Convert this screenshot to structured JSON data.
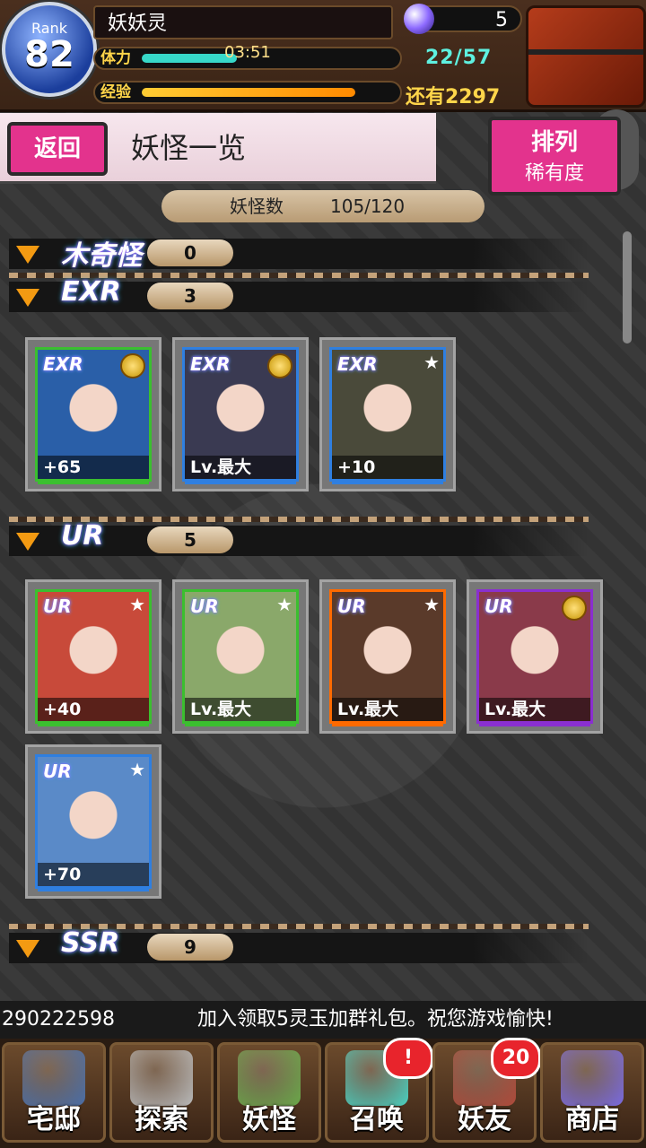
{
  "header": {
    "rank_label": "Rank",
    "rank_value": "82",
    "player_name": "妖妖灵",
    "stamina_label": "体力",
    "stamina_timer": "03:51",
    "stamina_value": "22/57",
    "stamina_fill": 0.38,
    "exp_label": "经验",
    "exp_remaining": "还有2297",
    "exp_fill": 0.85,
    "gems": "5"
  },
  "titlebar": {
    "back_label": "返回",
    "title": "妖怪一览",
    "sort_label": "排列",
    "sort_value": "稀有度"
  },
  "count": {
    "label": "妖怪数",
    "value": "105/120"
  },
  "sections": [
    {
      "rarity": "木奇怪",
      "count": "0"
    },
    {
      "rarity": "EXR",
      "count": "3"
    },
    {
      "rarity": "UR",
      "count": "5"
    },
    {
      "rarity": "SSR",
      "count": "9"
    }
  ],
  "exr_cards": [
    {
      "rarity": "EXR",
      "level": "+65",
      "badge": "medal",
      "frame": "#3bbf2f",
      "art": "#2a5fa8"
    },
    {
      "rarity": "EXR",
      "level": "Lv.最大",
      "badge": "medal",
      "frame": "#2f7fe0",
      "art": "#3a3a52"
    },
    {
      "rarity": "EXR",
      "level": "+10",
      "badge": "star",
      "frame": "#2f7fe0",
      "art": "#4a4a3a"
    }
  ],
  "ur_cards": [
    {
      "rarity": "UR",
      "level": "+40",
      "badge": "star",
      "frame": "#3bbf2f",
      "art": "#c84a3a"
    },
    {
      "rarity": "UR",
      "level": "Lv.最大",
      "badge": "star",
      "frame": "#3bbf2f",
      "art": "#8aa86a"
    },
    {
      "rarity": "UR",
      "level": "Lv.最大",
      "badge": "star",
      "frame": "#ff6a00",
      "art": "#5a3a2a"
    },
    {
      "rarity": "UR",
      "level": "Lv.最大",
      "badge": "medal",
      "frame": "#8a2fd0",
      "art": "#8a3a4a"
    },
    {
      "rarity": "UR",
      "level": "+70",
      "badge": "star",
      "frame": "#2f7fe0",
      "art": "#5a8ac8"
    }
  ],
  "ticker": {
    "id": "290222598",
    "message": "加入领取5灵玉加群礼包。祝您游戏愉快!"
  },
  "nav": [
    {
      "label": "宅邸",
      "icon": "house-icon",
      "color": "#4a6ea8"
    },
    {
      "label": "探索",
      "icon": "magnifier-icon",
      "color": "#b9b9b9"
    },
    {
      "label": "妖怪",
      "icon": "scroll-icon",
      "color": "#6aa84a"
    },
    {
      "label": "召唤",
      "icon": "pentagram-icon",
      "color": "#4ad0c0",
      "badge": "!"
    },
    {
      "label": "妖友",
      "icon": "friend-icon",
      "color": "#b04a3a",
      "badge": "20"
    },
    {
      "label": "商店",
      "icon": "orb-icon",
      "color": "#7a6ae0"
    }
  ]
}
